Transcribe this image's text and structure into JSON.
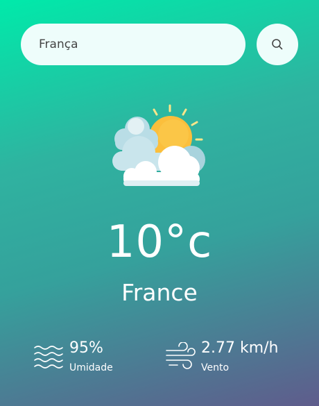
{
  "search": {
    "value": "França",
    "placeholder": ""
  },
  "weather": {
    "condition_icon": "sun-behind-clouds-icon",
    "temperature": "10°c",
    "city": "France"
  },
  "details": {
    "humidity": {
      "value": "95%",
      "label": "Umidade",
      "icon": "humidity-waves-icon"
    },
    "wind": {
      "value": "2.77 km/h",
      "label": "Vento",
      "icon": "wind-icon"
    }
  }
}
